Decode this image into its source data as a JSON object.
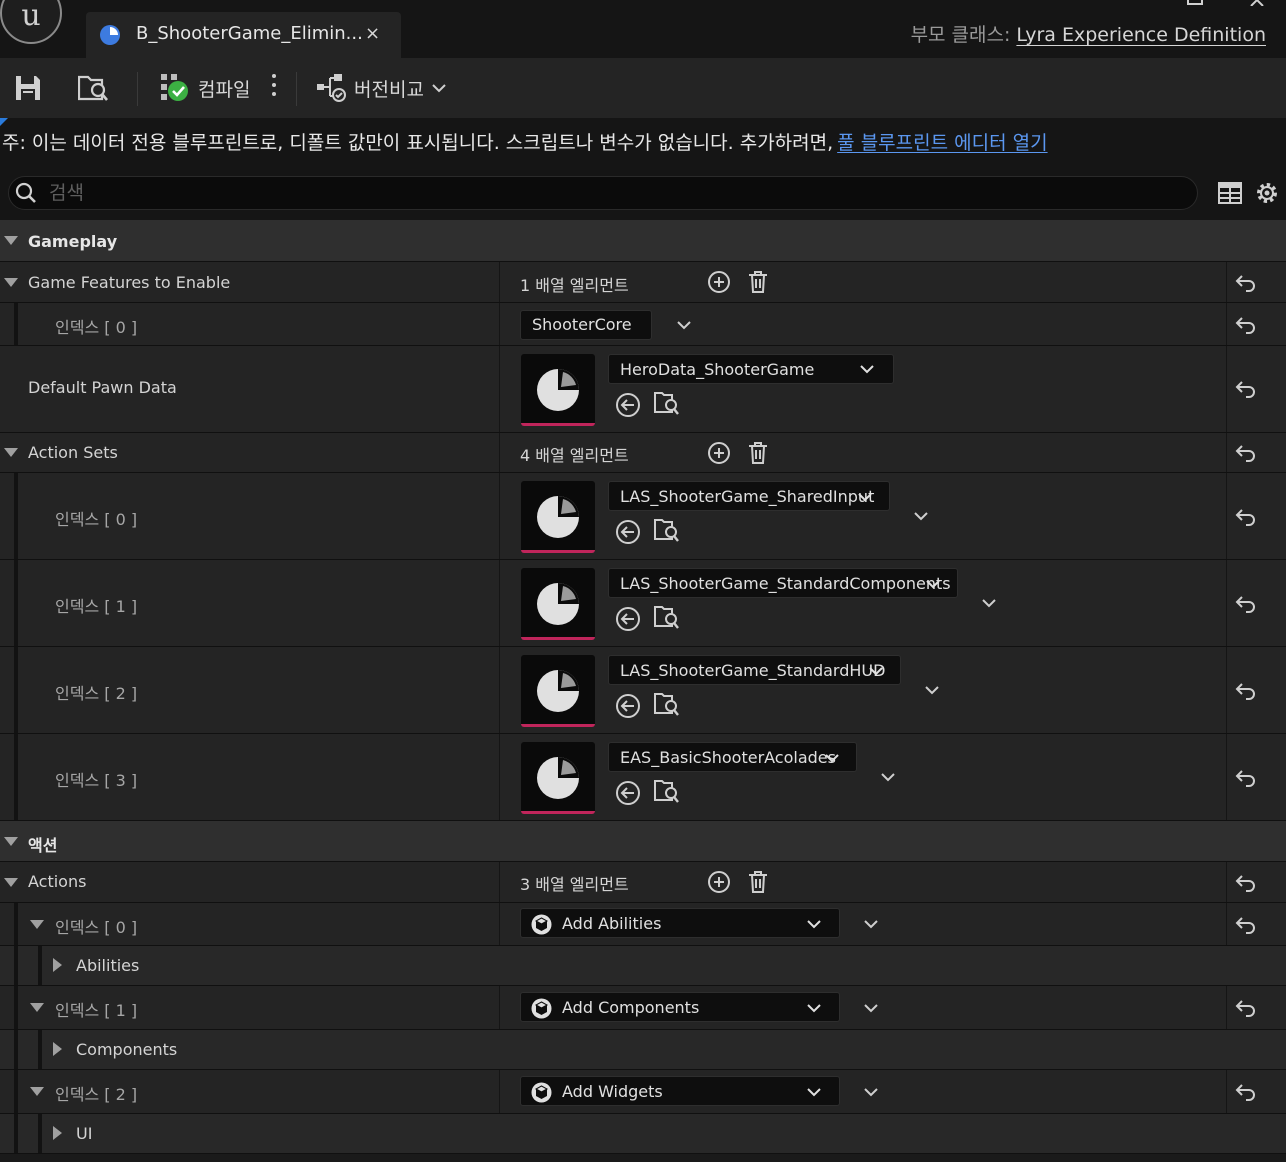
{
  "title_bar": {
    "logo_text": "u",
    "tab_title": "B_ShooterGame_Elimin...",
    "tab_close": "×",
    "parent_class_label": "부모 클래스:",
    "parent_class_value": "Lyra Experience Definition"
  },
  "toolbar": {
    "compile_label": "컴파일",
    "diff_label": "버전비교"
  },
  "notice": {
    "text": "주: 이는 데이터 전용 블루프린트로, 디폴트 값만이 표시됩니다. 스크립트나 변수가 없습니다. 추가하려면,",
    "link": "풀 블루프린트 에디터 열기"
  },
  "search": {
    "placeholder": "검색"
  },
  "details": {
    "gameplay_category": "Gameplay",
    "game_features": {
      "label": "Game Features to Enable",
      "count": "1 배열 엘리먼트",
      "items": [
        {
          "index": "인덱스 [ 0 ]",
          "value": "ShooterCore"
        }
      ]
    },
    "default_pawn": {
      "label": "Default Pawn Data",
      "value": "HeroData_ShooterGame"
    },
    "action_sets": {
      "label": "Action Sets",
      "count": "4 배열 엘리먼트",
      "items": [
        {
          "index": "인덱스 [ 0 ]",
          "value": "LAS_ShooterGame_SharedInput"
        },
        {
          "index": "인덱스 [ 1 ]",
          "value": "LAS_ShooterGame_StandardComponents"
        },
        {
          "index": "인덱스 [ 2 ]",
          "value": "LAS_ShooterGame_StandardHUD"
        },
        {
          "index": "인덱스 [ 3 ]",
          "value": "EAS_BasicShooterAcolades"
        }
      ]
    },
    "actions_category": "액션",
    "actions": {
      "label": "Actions",
      "count": "3 배열 엘리먼트",
      "items": [
        {
          "index": "인덱스 [ 0 ]",
          "value": "Add Abilities",
          "child": "Abilities"
        },
        {
          "index": "인덱스 [ 1 ]",
          "value": "Add Components",
          "child": "Components"
        },
        {
          "index": "인덱스 [ 2 ]",
          "value": "Add Widgets",
          "child": "UI"
        }
      ]
    }
  },
  "colors": {
    "accent_link": "#5b97f0",
    "asset_underline": "#c0255b",
    "compile_ok": "#3cb043",
    "tab_icon": "#3d7be0"
  }
}
